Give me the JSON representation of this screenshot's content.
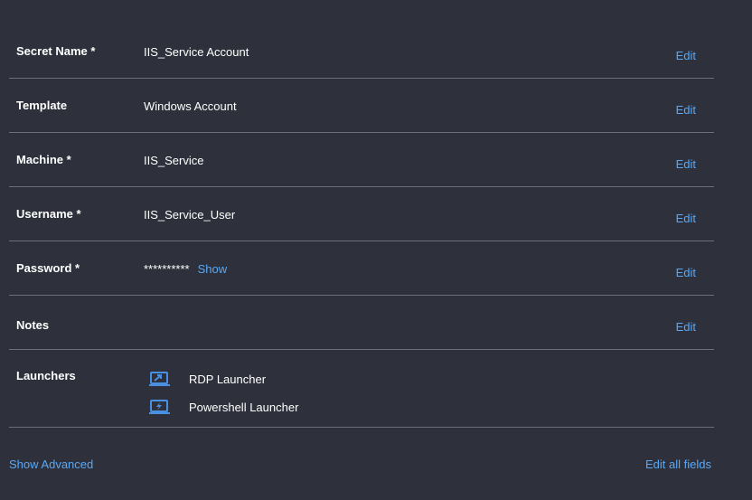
{
  "fields": [
    {
      "key": "secret-name",
      "label": "Secret Name *",
      "value": "IIS_Service Account",
      "edit_label": "Edit"
    },
    {
      "key": "template",
      "label": "Template",
      "value": "Windows Account",
      "edit_label": "Edit"
    },
    {
      "key": "machine",
      "label": "Machine *",
      "value": "IIS_Service",
      "edit_label": "Edit"
    },
    {
      "key": "username",
      "label": "Username *",
      "value": "IIS_Service_User",
      "edit_label": "Edit"
    },
    {
      "key": "password",
      "label": "Password *",
      "value": "**********",
      "show_label": "Show",
      "edit_label": "Edit"
    },
    {
      "key": "notes",
      "label": "Notes",
      "value": "",
      "edit_label": "Edit"
    }
  ],
  "launchers": {
    "label": "Launchers",
    "items": [
      {
        "name": "RDP Launcher",
        "icon": "rdp-launcher-icon"
      },
      {
        "name": "Powershell Launcher",
        "icon": "powershell-launcher-icon"
      }
    ]
  },
  "footer": {
    "show_advanced": "Show Advanced",
    "edit_all": "Edit all fields"
  },
  "colors": {
    "background": "#2e313b",
    "link": "#5aa8f5",
    "divider": "#6a6e78",
    "icon": "#4a90e2"
  }
}
